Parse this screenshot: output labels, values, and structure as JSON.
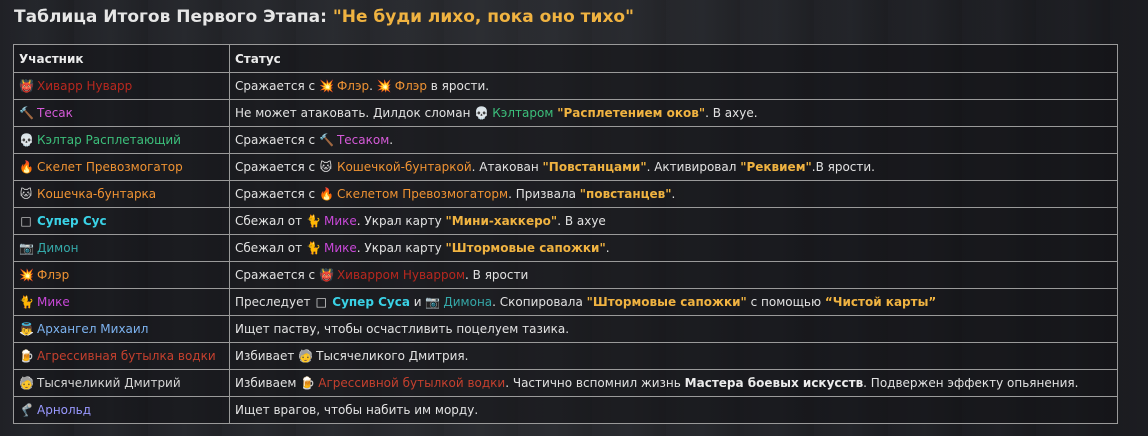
{
  "title": {
    "main": "Таблица Итогов Первого Этапа: ",
    "quote": "\"Не буди лихо, пока оно тихо\""
  },
  "headers": {
    "participant": "Участник",
    "status": "Статус"
  },
  "rows": [
    {
      "icon": "👹",
      "name": "Хиварр Нуварр"
    },
    {
      "icon": "🔨",
      "name": "Тесак"
    },
    {
      "icon": "💀",
      "name": "Кэлтар Расплетающий"
    },
    {
      "icon": "🔥",
      "name": "Скелет Превозмогатор"
    },
    {
      "icon": "🐱",
      "name": "Кошечка-бунтарка"
    },
    {
      "icon": "□",
      "name": "Супер Сус"
    },
    {
      "icon": "📷",
      "name": "Димон"
    },
    {
      "icon": "💥",
      "name": "Флэр"
    },
    {
      "icon": "🐈",
      "name": "Мике"
    },
    {
      "icon": "👼",
      "name": "Архангел Михаил"
    },
    {
      "icon": "🍺",
      "name": "Агрессивная бутылка водки"
    },
    {
      "icon": "🧓",
      "name": "Тысячеликий Дмитрий"
    },
    {
      "icon": "🦿",
      "name": "Арнольд"
    }
  ],
  "status": {
    "r0": {
      "t1": "Сражается с ",
      "i1": "💥",
      "n1": "Флэр",
      "t2": ". ",
      "i2": "💥",
      "n2": "Флэр",
      "t3": " в ярости."
    },
    "r1": {
      "t1": "Не может атаковать. Дилдок сломан ",
      "i1": "💀",
      "n1": "Кэлтаром",
      "t2": " ",
      "g1": "\"Расплетением оков\"",
      "t3": ". В ахуе."
    },
    "r2": {
      "t1": "Сражается с ",
      "i1": "🔨",
      "n1": "Тесаком",
      "t2": "."
    },
    "r3": {
      "t1": "Сражается с ",
      "i1": "🐱",
      "n1": "Кошечкой-бунтаркой",
      "t2": ". Атакован ",
      "g1": "\"Повстанцами\"",
      "t3": ". Активировал ",
      "g2": "\"Реквием\"",
      "t4": ".В ярости."
    },
    "r4": {
      "t1": "Сражается с ",
      "i1": "🔥",
      "n1": "Скелетом Превозмогаторм",
      "t2": ". Призвала ",
      "g1": "\"повстанцев\"",
      "t3": "."
    },
    "r5": {
      "t1": "Сбежал от ",
      "i1": "🐈",
      "n1": "Мике",
      "t2": ". Украл карту ",
      "g1": "\"Мини-хаккеро\"",
      "t3": ". В ахуе"
    },
    "r6": {
      "t1": "Сбежал от ",
      "i1": "🐈",
      "n1": "Мике",
      "t2": ". Украл карту ",
      "g1": "\"Штормовые сапожки\"",
      "t3": "."
    },
    "r7": {
      "t1": "Сражается с ",
      "i1": "👹",
      "n1": "Хиварром Нуварром",
      "t2": ". В ярости"
    },
    "r8": {
      "t1": "Преследует ",
      "i1": "□",
      "n1": "Супер Суса",
      "t2": " и ",
      "i2": "📷",
      "n2": "Димона",
      "t3": ". Скопировала ",
      "g1": "\"Штормовые сапожки\"",
      "t4": " с помощью ",
      "g2": "“Чистой карты”"
    },
    "r9": {
      "t1": "Ищет паству, чтобы осчастливить поцелуем тазика."
    },
    "r10": {
      "t1": "Избивает ",
      "i1": "🧓",
      "n1": "Тысячеликого Дмитрия",
      "t2": "."
    },
    "r11": {
      "t1": "Избиваем ",
      "i1": "🍺",
      "n1": "Агрессивной бутылкой водки",
      "t2": ". Частично вспомнил жизнь ",
      "b1": "Мастера боевых искусств",
      "t3": ". Подвержен эффекту опьянения."
    },
    "r12": {
      "t1": "Ищет врагов, чтобы набить им морду."
    }
  }
}
